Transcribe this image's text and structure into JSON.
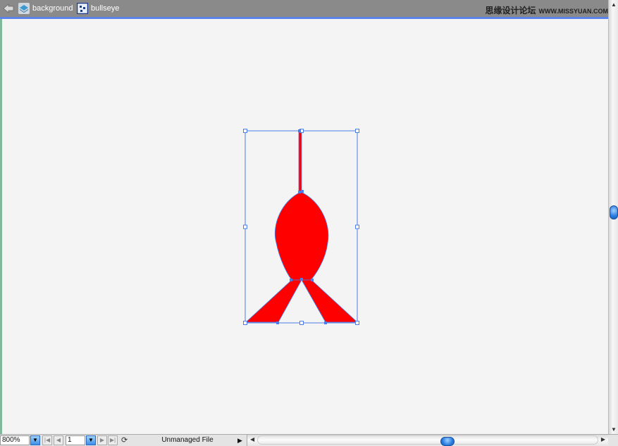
{
  "breadcrumb": {
    "back_icon": "back-arrow-icon",
    "items": [
      {
        "label": "background",
        "icon": "layer-stack-icon"
      },
      {
        "label": "bullseye",
        "icon": "symbol-icon"
      }
    ]
  },
  "watermark": {
    "text": "思缘设计论坛",
    "url": "WWW.MISSYUAN.COM"
  },
  "canvas": {
    "shape_fill": "#ff0000",
    "selection_color": "#4a7de8",
    "background": "#f4f4f4"
  },
  "statusbar": {
    "zoom": "800%",
    "page": "1",
    "status": "Unmanaged File",
    "first_page_icon": "first-page-icon",
    "prev_page_icon": "prev-page-icon",
    "next_page_icon": "next-page-icon",
    "last_page_icon": "last-page-icon",
    "tool_icon": "rotate-view-icon"
  },
  "scrollbars": {
    "vertical_position": 0.5,
    "horizontal_position": 0.52
  }
}
